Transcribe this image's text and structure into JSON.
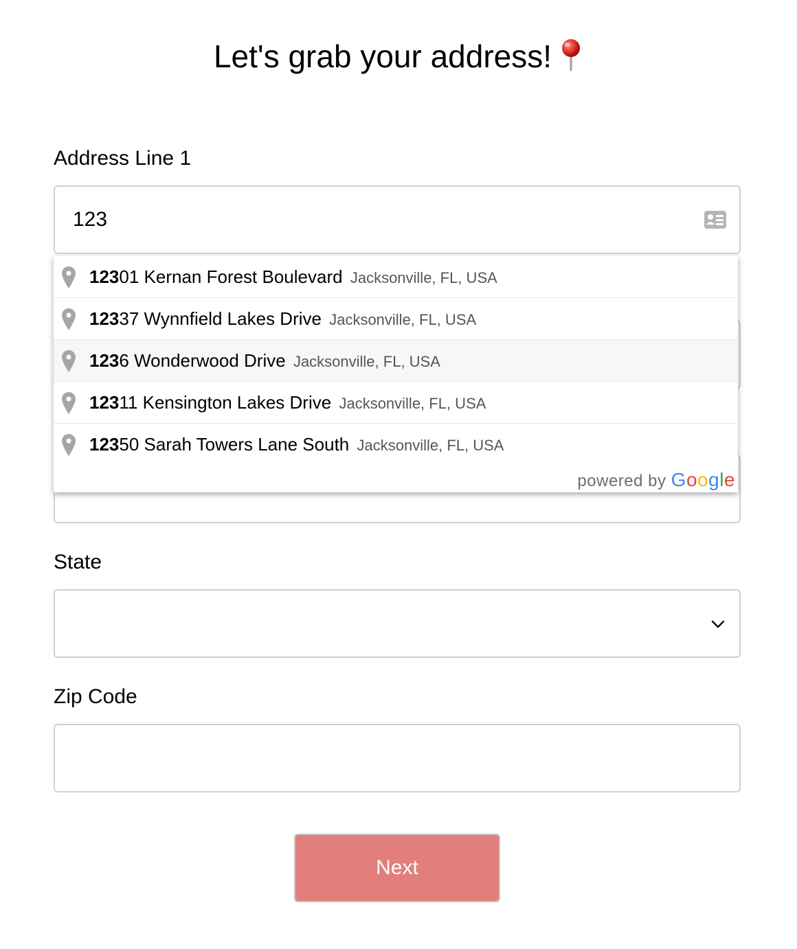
{
  "page": {
    "title": "Let's grab your address!",
    "title_emoji": "round-pushpin-icon"
  },
  "address_line_1": {
    "label": "Address Line 1",
    "value": "123",
    "icon": "contact-card-icon"
  },
  "autocomplete": {
    "query_match": "123",
    "suggestions": [
      {
        "match": "123",
        "rest": "01 Kernan Forest Boulevard",
        "secondary": "Jacksonville, FL, USA"
      },
      {
        "match": "123",
        "rest": "37 Wynnfield Lakes Drive",
        "secondary": "Jacksonville, FL, USA"
      },
      {
        "match": "123",
        "rest": "6 Wonderwood Drive",
        "secondary": "Jacksonville, FL, USA",
        "highlighted": true
      },
      {
        "match": "123",
        "rest": "11 Kensington Lakes Drive",
        "secondary": "Jacksonville, FL, USA"
      },
      {
        "match": "123",
        "rest": "50 Sarah Towers Lane South",
        "secondary": "Jacksonville, FL, USA"
      }
    ],
    "attribution_prefix": "powered by",
    "attribution_brand": [
      "G",
      "o",
      "o",
      "g",
      "l",
      "e"
    ],
    "brand_colors": [
      "#4285f4",
      "#ea4335",
      "#fbbc05",
      "#4285f4",
      "#34a853",
      "#ea4335"
    ]
  },
  "state": {
    "label": "State",
    "value": "",
    "icon": "chevron-down-icon"
  },
  "zip_code": {
    "label": "Zip Code",
    "value": ""
  },
  "next_button": {
    "label": "Next",
    "color": "#e27e7b"
  }
}
